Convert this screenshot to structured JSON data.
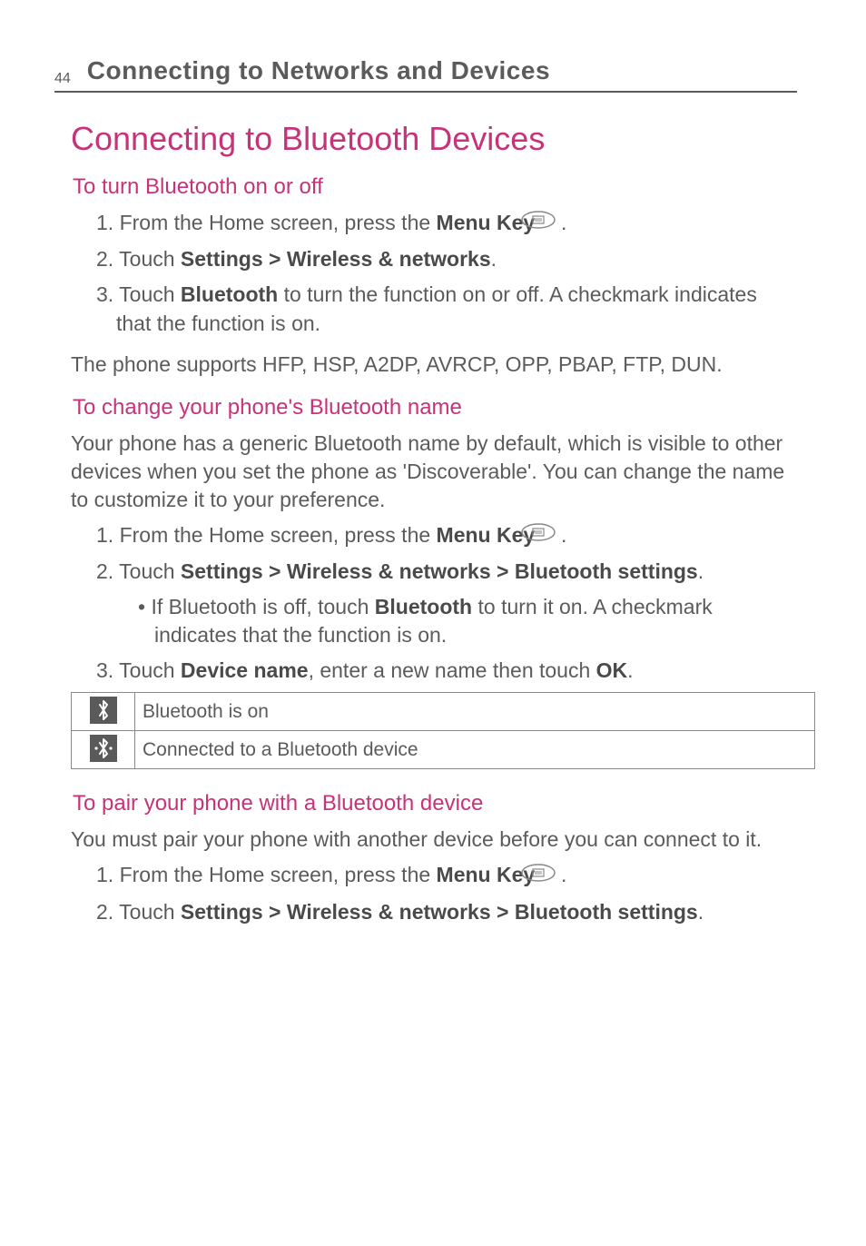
{
  "page_number": "44",
  "chapter_title": "Connecting to Networks and Devices",
  "main_title": "Connecting to Bluetooth Devices",
  "section1": {
    "heading": "To turn Bluetooth on or off",
    "step1_pre": "1. From the Home screen, press the ",
    "step1_bold": "Menu Key",
    "step1_post": " ",
    "step1_end": " .",
    "step2_pre": "2. Touch ",
    "step2_bold": "Settings > Wireless & networks",
    "step2_post": ".",
    "step3_pre": "3. Touch ",
    "step3_bold": "Bluetooth",
    "step3_post": " to turn the function on or off. A checkmark indicates that the function is on.",
    "note": "The phone supports HFP, HSP, A2DP, AVRCP, OPP, PBAP, FTP, DUN."
  },
  "section2": {
    "heading": "To change your phone's Bluetooth name",
    "intro": "Your phone has a generic Bluetooth name by default, which is visible to other devices when you set the phone as 'Discoverable'. You can change the name to customize it to your preference.",
    "step1_pre": "1. From the Home screen, press the ",
    "step1_bold": "Menu Key",
    "step1_end": " .",
    "step2_pre": "2. Touch ",
    "step2_bold": "Settings > Wireless & networks > Bluetooth settings",
    "step2_post": ".",
    "bullet_pre": "• If Bluetooth is off, touch ",
    "bullet_bold": "Bluetooth",
    "bullet_post": " to turn it on. A checkmark indicates that the function is on.",
    "step3_pre": "3. Touch ",
    "step3_bold1": "Device name",
    "step3_mid": ", enter a new name then touch ",
    "step3_bold2": "OK",
    "step3_post": "."
  },
  "table": {
    "row1": "Bluetooth is on",
    "row2": "Connected to a Bluetooth device"
  },
  "section3": {
    "heading": "To pair your phone with a Bluetooth device",
    "intro": "You must pair your phone with another device before you can connect to it.",
    "step1_pre": "1. From the Home screen, press the ",
    "step1_bold": "Menu Key",
    "step1_end": " .",
    "step2_pre": "2. Touch ",
    "step2_bold": "Settings > Wireless & networks > Bluetooth settings",
    "step2_post": "."
  },
  "icons": {
    "bt_on": "✱",
    "bt_connected": "❋"
  }
}
